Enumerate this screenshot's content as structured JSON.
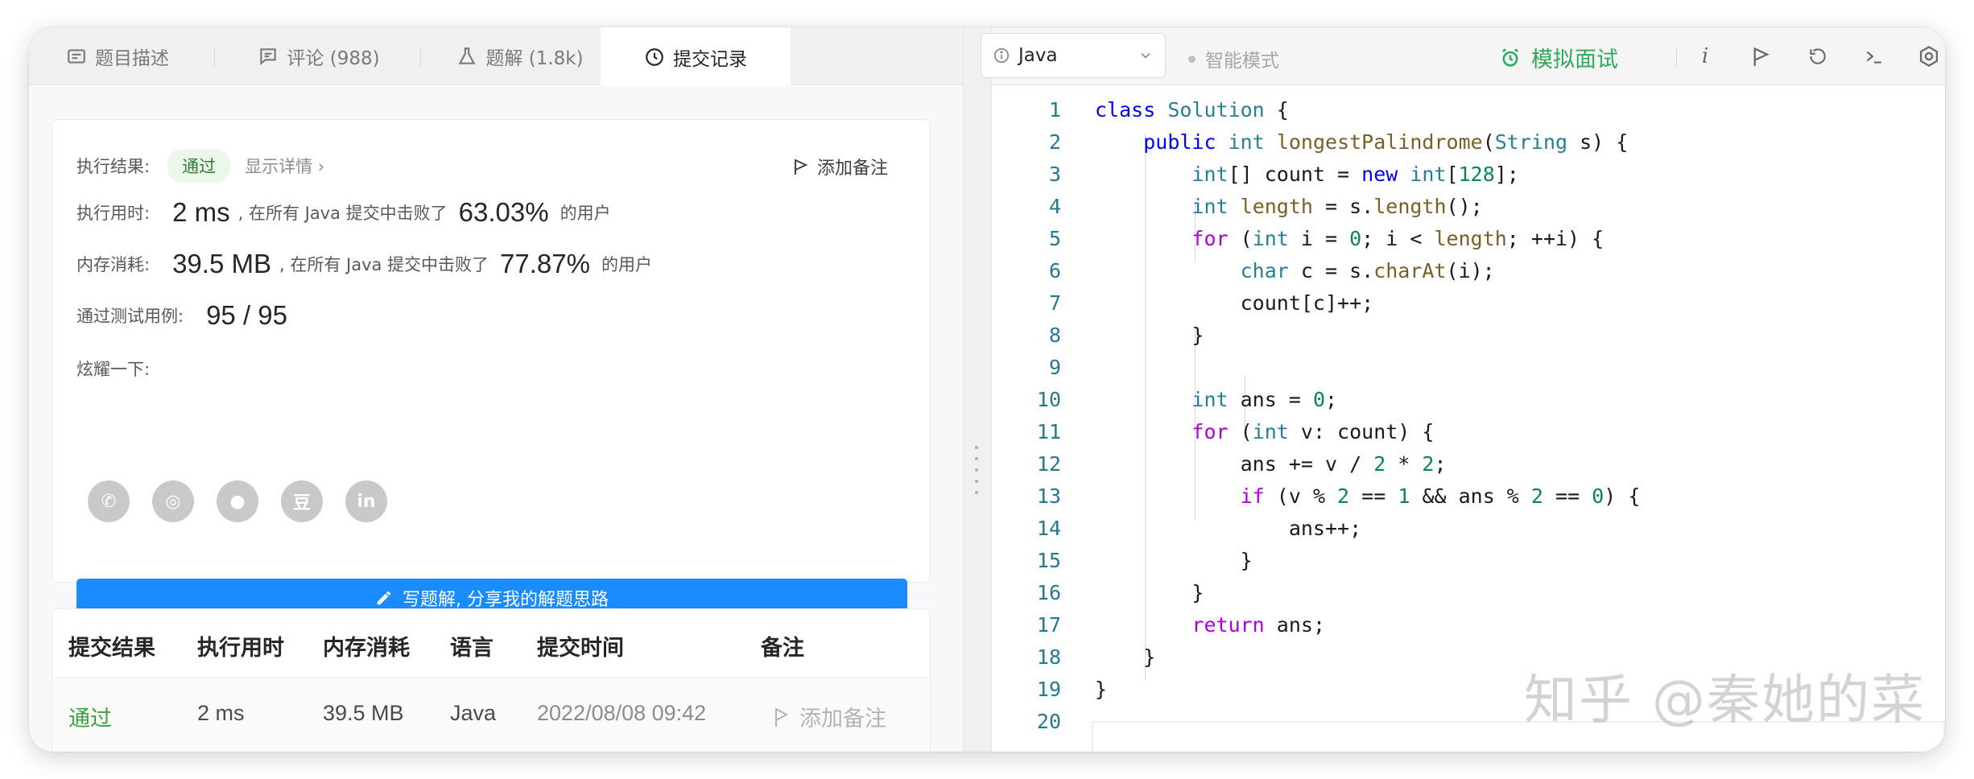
{
  "tabs": [
    {
      "label": "题目描述"
    },
    {
      "label": "评论 (988)"
    },
    {
      "label": "题解 (1.8k)"
    },
    {
      "label": "提交记录"
    }
  ],
  "result": {
    "exec_result_label": "执行结果:",
    "status": "通过",
    "show_detail": "显示详情 ›",
    "add_note": "添加备注",
    "time_label": "执行用时:",
    "time_value": "2 ms",
    "time_mid": ", 在所有 Java 提交中击败了",
    "time_percent": "63.03%",
    "time_suffix": "的用户",
    "mem_label": "内存消耗:",
    "mem_value": "39.5 MB",
    "mem_mid": ", 在所有 Java 提交中击败了",
    "mem_percent": "77.87%",
    "mem_suffix": "的用户",
    "tests_label": "通过测试用例:",
    "tests_value": "95 / 95",
    "share_label": "炫耀一下:",
    "write_button": "写题解, 分享我的解题思路"
  },
  "share_icons": [
    "wechat-icon",
    "weibo-icon",
    "qq-icon",
    "douban-icon",
    "linkedin-icon"
  ],
  "share_glyphs": [
    "✆",
    "◎",
    "●",
    "豆",
    "in"
  ],
  "table": {
    "headers": [
      "提交结果",
      "执行用时",
      "内存消耗",
      "语言",
      "提交时间",
      "备注"
    ],
    "rows": [
      {
        "result": "通过",
        "time": "2 ms",
        "memory": "39.5 MB",
        "lang": "Java",
        "submitted": "2022/08/08 09:42",
        "note": "添加备注"
      }
    ]
  },
  "toolbar": {
    "language": "Java",
    "smart_mode": "智能模式",
    "mock_interview": "模拟面试"
  },
  "code_lines": [
    "class Solution {",
    "    public int longestPalindrome(String s) {",
    "        int[] count = new int[128];",
    "        int length = s.length();",
    "        for (int i = 0; i < length; ++i) {",
    "            char c = s.charAt(i);",
    "            count[c]++;",
    "        }",
    "",
    "        int ans = 0;",
    "        for (int v: count) {",
    "            ans += v / 2 * 2;",
    "            if (v % 2 == 1 && ans % 2 == 0) {",
    "                ans++;",
    "            }",
    "        }",
    "        return ans;",
    "    }",
    "}",
    ""
  ],
  "watermark": "知乎 @秦她的菜",
  "colors": {
    "accent_blue": "#1a8cff",
    "pass_green": "#2e7d32",
    "mock_green": "#2eaa5a"
  }
}
